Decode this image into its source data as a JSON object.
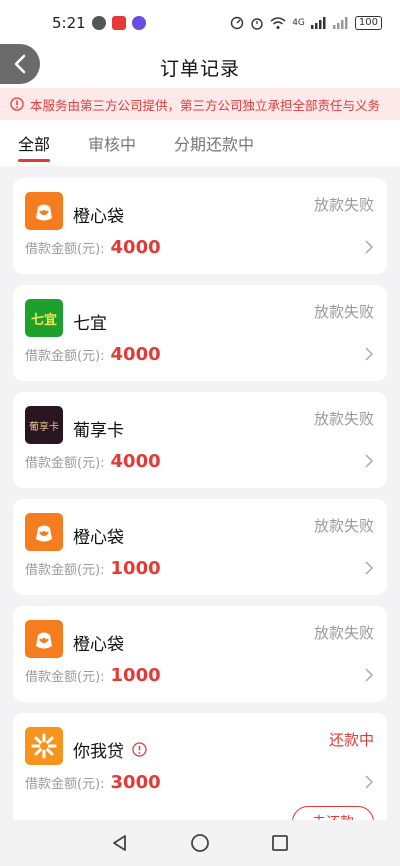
{
  "status_bar": {
    "time": "5:21",
    "network_label": "4G",
    "battery": "100"
  },
  "header": {
    "title": "订单记录"
  },
  "notice": {
    "text": "本服务由第三方公司提供，第三方公司独立承担全部责任与义务"
  },
  "tabs": [
    {
      "label": "全部",
      "active": true
    },
    {
      "label": "审核中",
      "active": false
    },
    {
      "label": "分期还款中",
      "active": false
    }
  ],
  "orders": [
    {
      "name": "橙心袋",
      "status": "放款失败",
      "amount_label": "借款金额(元):",
      "amount": "4000",
      "logo": "orange-bag-logo"
    },
    {
      "name": "七宜",
      "status": "放款失败",
      "amount_label": "借款金额(元):",
      "amount": "4000",
      "logo": "qiyi-logo",
      "logo_text": "七宜"
    },
    {
      "name": "葡享卡",
      "status": "放款失败",
      "amount_label": "借款金额(元):",
      "amount": "4000",
      "logo": "puxiangka-logo",
      "logo_text": "葡享卡"
    },
    {
      "name": "橙心袋",
      "status": "放款失败",
      "amount_label": "借款金额(元):",
      "amount": "1000",
      "logo": "orange-bag-logo"
    },
    {
      "name": "橙心袋",
      "status": "放款失败",
      "amount_label": "借款金额(元):",
      "amount": "1000",
      "logo": "orange-bag-logo"
    },
    {
      "name": "你我贷",
      "status": "还款中",
      "amount_label": "借款金额(元):",
      "amount": "3000",
      "logo": "niwodai-logo",
      "action": "去还款"
    }
  ],
  "colors": {
    "accent": "#e53935",
    "notice_bg": "#fde9e9",
    "status_grey": "#9a9a9a",
    "page_bg": "#f3f3f5"
  }
}
